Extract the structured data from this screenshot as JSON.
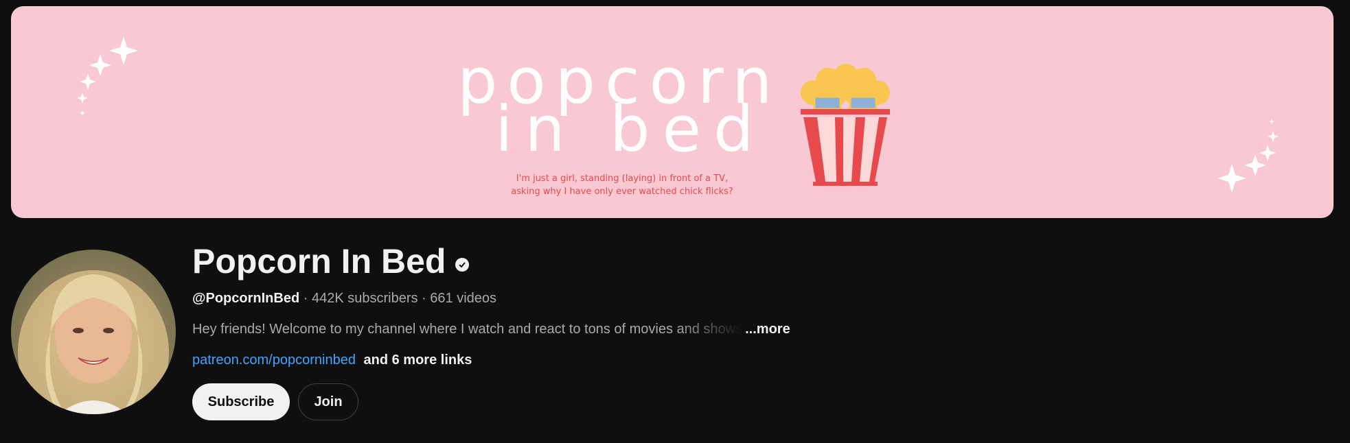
{
  "banner": {
    "logo_line1": "popcorn",
    "logo_line2": "in bed",
    "tagline_line1": "I'm just a girl, standing (laying) in front of a TV,",
    "tagline_line2": "asking why I have only ever watched chick flicks?",
    "background_color": "#f8c8d3",
    "accent_color": "#e8494c",
    "popcorn_color": "#f9c74f"
  },
  "channel": {
    "name": "Popcorn In Bed",
    "verified_icon": "checkmark-circle-icon",
    "handle": "@PopcornInBed",
    "subscribers": "442K subscribers",
    "videos": "661 videos",
    "separator": " · ",
    "description": "Hey friends! Welcome to my channel where I watch and react to tons of movies and shows",
    "more_label": "...more",
    "link": "patreon.com/popcorninbed",
    "more_links": "and 6 more links"
  },
  "actions": {
    "subscribe_label": "Subscribe",
    "join_label": "Join"
  }
}
